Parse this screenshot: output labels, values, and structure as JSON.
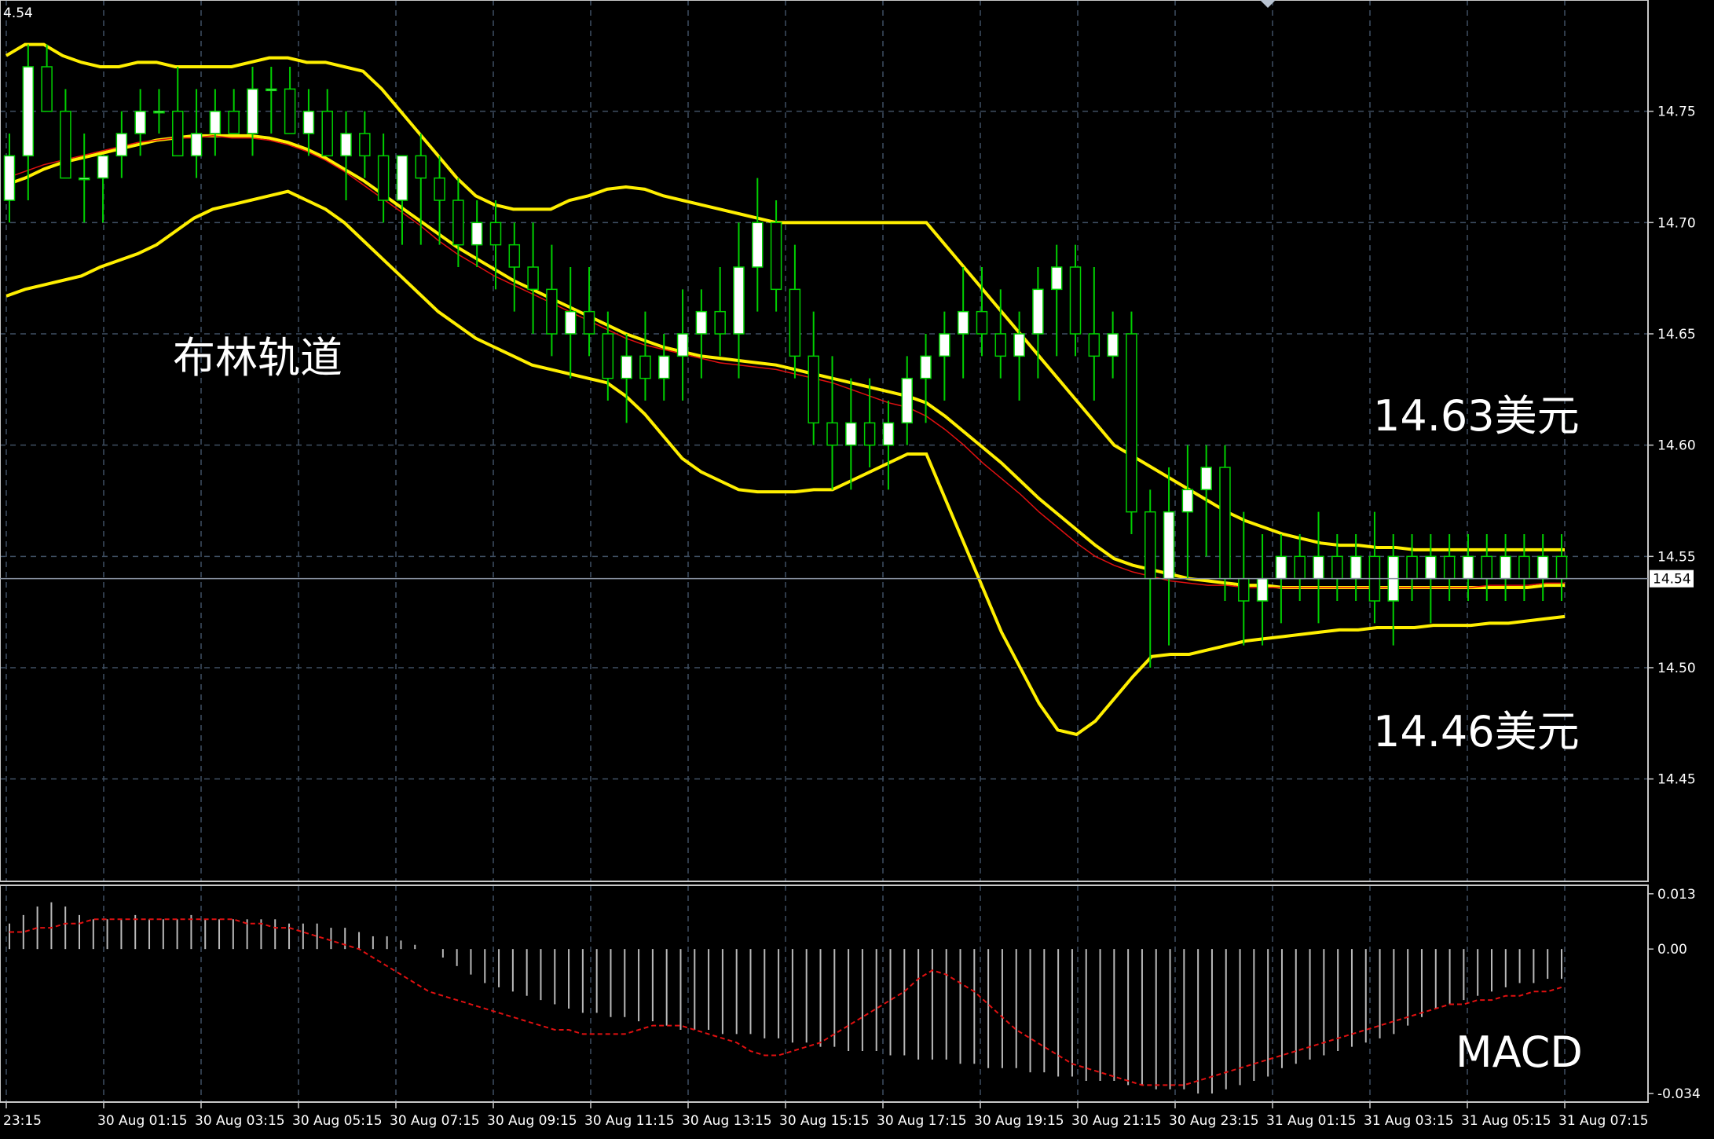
{
  "chart_data": {
    "type": "candlestick",
    "price_panel": {
      "corner_label": "4.54",
      "y_ticks": [
        "14.75",
        "14.70",
        "14.65",
        "14.60",
        "14.55",
        "14.50",
        "14.45"
      ],
      "y_tick_values": [
        14.75,
        14.7,
        14.65,
        14.6,
        14.55,
        14.5,
        14.45
      ],
      "ylim": [
        14.404,
        14.8
      ],
      "current_price": 14.54,
      "current_price_label": "14.54",
      "grid": true,
      "indicators": [
        "Bollinger Bands (upper, middle, lower)",
        "Moving average"
      ],
      "candles": [
        [
          14.71,
          14.74,
          14.7,
          14.73
        ],
        [
          14.73,
          14.78,
          14.71,
          14.77
        ],
        [
          14.77,
          14.78,
          14.75,
          14.75
        ],
        [
          14.75,
          14.76,
          14.72,
          14.72
        ],
        [
          14.72,
          14.74,
          14.7,
          14.72
        ],
        [
          14.72,
          14.73,
          14.7,
          14.73
        ],
        [
          14.73,
          14.75,
          14.72,
          14.74
        ],
        [
          14.74,
          14.76,
          14.73,
          14.75
        ],
        [
          14.75,
          14.76,
          14.74,
          14.75
        ],
        [
          14.75,
          14.77,
          14.73,
          14.73
        ],
        [
          14.73,
          14.76,
          14.72,
          14.74
        ],
        [
          14.74,
          14.76,
          14.73,
          14.75
        ],
        [
          14.75,
          14.76,
          14.74,
          14.74
        ],
        [
          14.74,
          14.77,
          14.73,
          14.76
        ],
        [
          14.76,
          14.77,
          14.74,
          14.76
        ],
        [
          14.76,
          14.77,
          14.74,
          14.74
        ],
        [
          14.74,
          14.76,
          14.73,
          14.75
        ],
        [
          14.75,
          14.76,
          14.73,
          14.73
        ],
        [
          14.73,
          14.75,
          14.71,
          14.74
        ],
        [
          14.74,
          14.75,
          14.72,
          14.73
        ],
        [
          14.73,
          14.74,
          14.7,
          14.71
        ],
        [
          14.71,
          14.73,
          14.69,
          14.73
        ],
        [
          14.73,
          14.74,
          14.69,
          14.72
        ],
        [
          14.72,
          14.73,
          14.69,
          14.71
        ],
        [
          14.71,
          14.72,
          14.68,
          14.69
        ],
        [
          14.69,
          14.71,
          14.68,
          14.7
        ],
        [
          14.7,
          14.71,
          14.67,
          14.69
        ],
        [
          14.69,
          14.7,
          14.66,
          14.68
        ],
        [
          14.68,
          14.7,
          14.65,
          14.67
        ],
        [
          14.67,
          14.69,
          14.64,
          14.65
        ],
        [
          14.65,
          14.68,
          14.63,
          14.66
        ],
        [
          14.66,
          14.68,
          14.64,
          14.65
        ],
        [
          14.65,
          14.66,
          14.62,
          14.63
        ],
        [
          14.63,
          14.65,
          14.61,
          14.64
        ],
        [
          14.64,
          14.66,
          14.62,
          14.63
        ],
        [
          14.63,
          14.65,
          14.62,
          14.64
        ],
        [
          14.64,
          14.67,
          14.62,
          14.65
        ],
        [
          14.65,
          14.67,
          14.63,
          14.66
        ],
        [
          14.66,
          14.68,
          14.64,
          14.65
        ],
        [
          14.65,
          14.7,
          14.63,
          14.68
        ],
        [
          14.68,
          14.72,
          14.66,
          14.7
        ],
        [
          14.7,
          14.71,
          14.66,
          14.67
        ],
        [
          14.67,
          14.69,
          14.63,
          14.64
        ],
        [
          14.64,
          14.66,
          14.6,
          14.61
        ],
        [
          14.61,
          14.64,
          14.58,
          14.6
        ],
        [
          14.6,
          14.63,
          14.58,
          14.61
        ],
        [
          14.61,
          14.63,
          14.59,
          14.6
        ],
        [
          14.6,
          14.62,
          14.58,
          14.61
        ],
        [
          14.61,
          14.64,
          14.6,
          14.63
        ],
        [
          14.63,
          14.65,
          14.61,
          14.64
        ],
        [
          14.64,
          14.66,
          14.62,
          14.65
        ],
        [
          14.65,
          14.68,
          14.63,
          14.66
        ],
        [
          14.66,
          14.68,
          14.64,
          14.65
        ],
        [
          14.65,
          14.67,
          14.63,
          14.64
        ],
        [
          14.64,
          14.66,
          14.62,
          14.65
        ],
        [
          14.65,
          14.68,
          14.63,
          14.67
        ],
        [
          14.67,
          14.69,
          14.64,
          14.68
        ],
        [
          14.68,
          14.69,
          14.64,
          14.65
        ],
        [
          14.65,
          14.68,
          14.62,
          14.64
        ],
        [
          14.64,
          14.66,
          14.63,
          14.65
        ],
        [
          14.65,
          14.66,
          14.56,
          14.57
        ],
        [
          14.57,
          14.58,
          14.5,
          14.54
        ],
        [
          14.54,
          14.59,
          14.51,
          14.57
        ],
        [
          14.57,
          14.6,
          14.54,
          14.58
        ],
        [
          14.58,
          14.6,
          14.55,
          14.59
        ],
        [
          14.59,
          14.6,
          14.53,
          14.54
        ],
        [
          14.54,
          14.57,
          14.51,
          14.53
        ],
        [
          14.53,
          14.56,
          14.51,
          14.54
        ],
        [
          14.54,
          14.56,
          14.52,
          14.55
        ],
        [
          14.55,
          14.56,
          14.53,
          14.54
        ],
        [
          14.54,
          14.57,
          14.52,
          14.55
        ],
        [
          14.55,
          14.56,
          14.53,
          14.54
        ],
        [
          14.54,
          14.56,
          14.53,
          14.55
        ],
        [
          14.55,
          14.57,
          14.52,
          14.53
        ],
        [
          14.53,
          14.56,
          14.51,
          14.55
        ],
        [
          14.55,
          14.56,
          14.53,
          14.54
        ],
        [
          14.54,
          14.56,
          14.52,
          14.55
        ],
        [
          14.55,
          14.56,
          14.53,
          14.54
        ],
        [
          14.54,
          14.56,
          14.53,
          14.55
        ],
        [
          14.55,
          14.56,
          14.53,
          14.54
        ],
        [
          14.54,
          14.56,
          14.53,
          14.55
        ],
        [
          14.55,
          14.56,
          14.53,
          14.54
        ],
        [
          14.54,
          14.56,
          14.53,
          14.55
        ],
        [
          14.55,
          14.56,
          14.53,
          14.54
        ]
      ],
      "bollinger_upper": [
        14.775,
        14.78,
        14.78,
        14.775,
        14.772,
        14.77,
        14.77,
        14.772,
        14.772,
        14.77,
        14.77,
        14.77,
        14.77,
        14.772,
        14.774,
        14.774,
        14.772,
        14.772,
        14.77,
        14.768,
        14.76,
        14.75,
        14.74,
        14.73,
        14.72,
        14.712,
        14.708,
        14.706,
        14.706,
        14.706,
        14.71,
        14.712,
        14.715,
        14.716,
        14.715,
        14.712,
        14.71,
        14.708,
        14.706,
        14.704,
        14.702,
        14.7,
        14.7,
        14.7,
        14.7,
        14.7,
        14.7,
        14.7,
        14.7,
        14.7,
        14.69,
        14.68,
        14.67,
        14.66,
        14.65,
        14.64,
        14.63,
        14.62,
        14.61,
        14.6,
        14.595,
        14.59,
        14.585,
        14.58,
        14.575,
        14.57,
        14.566,
        14.563,
        14.56,
        14.558,
        14.556,
        14.555,
        14.555,
        14.554,
        14.554,
        14.553,
        14.553,
        14.553,
        14.553,
        14.553,
        14.553,
        14.553,
        14.553,
        14.553
      ],
      "bollinger_middle": [
        14.717,
        14.72,
        14.724,
        14.727,
        14.729,
        14.731,
        14.733,
        14.735,
        14.737,
        14.738,
        14.739,
        14.739,
        14.739,
        14.739,
        14.738,
        14.736,
        14.733,
        14.729,
        14.724,
        14.719,
        14.713,
        14.707,
        14.701,
        14.695,
        14.689,
        14.684,
        14.679,
        14.674,
        14.67,
        14.666,
        14.662,
        14.658,
        14.654,
        14.65,
        14.647,
        14.644,
        14.642,
        14.64,
        14.639,
        14.638,
        14.637,
        14.636,
        14.634,
        14.632,
        14.63,
        14.628,
        14.626,
        14.624,
        14.622,
        14.619,
        14.613,
        14.606,
        14.599,
        14.592,
        14.584,
        14.576,
        14.569,
        14.562,
        14.555,
        14.549,
        14.546,
        14.544,
        14.542,
        14.54,
        14.539,
        14.538,
        14.537,
        14.537,
        14.536,
        14.536,
        14.536,
        14.536,
        14.536,
        14.536,
        14.536,
        14.536,
        14.536,
        14.536,
        14.536,
        14.536,
        14.536,
        14.536,
        14.537,
        14.537
      ],
      "bollinger_lower": [
        14.667,
        14.67,
        14.672,
        14.674,
        14.676,
        14.68,
        14.683,
        14.686,
        14.69,
        14.696,
        14.702,
        14.706,
        14.708,
        14.71,
        14.712,
        14.714,
        14.71,
        14.706,
        14.7,
        14.692,
        14.684,
        14.676,
        14.668,
        14.66,
        14.654,
        14.648,
        14.644,
        14.64,
        14.636,
        14.634,
        14.632,
        14.63,
        14.628,
        14.622,
        14.614,
        14.604,
        14.594,
        14.588,
        14.584,
        14.58,
        14.579,
        14.579,
        14.579,
        14.58,
        14.58,
        14.584,
        14.588,
        14.592,
        14.596,
        14.596,
        14.576,
        14.556,
        14.536,
        14.516,
        14.5,
        14.484,
        14.472,
        14.47,
        14.476,
        14.486,
        14.496,
        14.505,
        14.506,
        14.506,
        14.508,
        14.51,
        14.512,
        14.513,
        14.514,
        14.515,
        14.516,
        14.517,
        14.517,
        14.518,
        14.518,
        14.518,
        14.519,
        14.519,
        14.519,
        14.52,
        14.52,
        14.521,
        14.522,
        14.523
      ],
      "moving_average": [
        14.72,
        14.723,
        14.726,
        14.728,
        14.73,
        14.732,
        14.734,
        14.736,
        14.737,
        14.738,
        14.738,
        14.739,
        14.738,
        14.738,
        14.737,
        14.735,
        14.732,
        14.728,
        14.723,
        14.717,
        14.711,
        14.705,
        14.699,
        14.692,
        14.686,
        14.681,
        14.676,
        14.672,
        14.668,
        14.664,
        14.66,
        14.656,
        14.652,
        14.648,
        14.645,
        14.643,
        14.641,
        14.639,
        14.637,
        14.636,
        14.635,
        14.634,
        14.632,
        14.63,
        14.628,
        14.625,
        14.622,
        14.619,
        14.617,
        14.613,
        14.607,
        14.6,
        14.592,
        14.585,
        14.578,
        14.57,
        14.563,
        14.556,
        14.55,
        14.546,
        14.543,
        14.541,
        14.539,
        14.538,
        14.537,
        14.537,
        14.536,
        14.536,
        14.536,
        14.536,
        14.536,
        14.536,
        14.536,
        14.536,
        14.536,
        14.536,
        14.536,
        14.536,
        14.536,
        14.537,
        14.537,
        14.537,
        14.538,
        14.538
      ]
    },
    "macd_panel": {
      "title": "MACD",
      "y_ticks": [
        "0.013",
        "0.00",
        "-0.034"
      ],
      "y_tick_values": [
        0.013,
        0.0,
        -0.034
      ],
      "ylim": [
        -0.036,
        0.015
      ],
      "histogram": [
        0.006,
        0.008,
        0.01,
        0.011,
        0.01,
        0.008,
        0.007,
        0.007,
        0.007,
        0.008,
        0.007,
        0.007,
        0.007,
        0.008,
        0.007,
        0.007,
        0.007,
        0.007,
        0.007,
        0.007,
        0.006,
        0.006,
        0.006,
        0.005,
        0.005,
        0.004,
        0.003,
        0.003,
        0.002,
        0.001,
        0.0,
        -0.002,
        -0.004,
        -0.006,
        -0.008,
        -0.009,
        -0.01,
        -0.011,
        -0.012,
        -0.013,
        -0.014,
        -0.015,
        -0.015,
        -0.016,
        -0.016,
        -0.017,
        -0.017,
        -0.018,
        -0.019,
        -0.019,
        -0.019,
        -0.02,
        -0.02,
        -0.02,
        -0.021,
        -0.021,
        -0.022,
        -0.022,
        -0.023,
        -0.023,
        -0.024,
        -0.024,
        -0.024,
        -0.025,
        -0.025,
        -0.026,
        -0.026,
        -0.026,
        -0.027,
        -0.027,
        -0.028,
        -0.028,
        -0.028,
        -0.029,
        -0.029,
        -0.03,
        -0.03,
        -0.031,
        -0.031,
        -0.031,
        -0.032,
        -0.032,
        -0.033,
        -0.033,
        -0.033,
        -0.034,
        -0.034,
        -0.033,
        -0.032,
        -0.031,
        -0.03,
        -0.028,
        -0.027,
        -0.026,
        -0.025,
        -0.024,
        -0.023,
        -0.022,
        -0.021,
        -0.02,
        -0.018,
        -0.016,
        -0.014,
        -0.013,
        -0.012,
        -0.011,
        -0.01,
        -0.009,
        -0.008,
        -0.008,
        -0.007,
        -0.007
      ],
      "signal": [
        0.004,
        0.004,
        0.005,
        0.005,
        0.006,
        0.006,
        0.007,
        0.007,
        0.007,
        0.007,
        0.007,
        0.007,
        0.007,
        0.007,
        0.007,
        0.007,
        0.007,
        0.006,
        0.006,
        0.005,
        0.005,
        0.004,
        0.003,
        0.002,
        0.001,
        0.0,
        -0.002,
        -0.004,
        -0.006,
        -0.008,
        -0.01,
        -0.011,
        -0.012,
        -0.013,
        -0.014,
        -0.015,
        -0.016,
        -0.017,
        -0.018,
        -0.019,
        -0.019,
        -0.02,
        -0.02,
        -0.02,
        -0.02,
        -0.019,
        -0.018,
        -0.018,
        -0.018,
        -0.019,
        -0.02,
        -0.021,
        -0.022,
        -0.024,
        -0.025,
        -0.025,
        -0.024,
        -0.023,
        -0.022,
        -0.02,
        -0.018,
        -0.016,
        -0.014,
        -0.012,
        -0.01,
        -0.007,
        -0.005,
        -0.006,
        -0.008,
        -0.01,
        -0.013,
        -0.016,
        -0.019,
        -0.021,
        -0.023,
        -0.025,
        -0.027,
        -0.028,
        -0.029,
        -0.03,
        -0.031,
        -0.032,
        -0.032,
        -0.032,
        -0.032,
        -0.031,
        -0.03,
        -0.029,
        -0.028,
        -0.027,
        -0.026,
        -0.025,
        -0.024,
        -0.023,
        -0.022,
        -0.021,
        -0.02,
        -0.019,
        -0.018,
        -0.017,
        -0.016,
        -0.015,
        -0.014,
        -0.013,
        -0.013,
        -0.012,
        -0.012,
        -0.011,
        -0.011,
        -0.01,
        -0.01,
        -0.009
      ]
    },
    "x_ticks": [
      "23:15",
      "30 Aug 01:15",
      "30 Aug 03:15",
      "30 Aug 05:15",
      "30 Aug 07:15",
      "30 Aug 09:15",
      "30 Aug 11:15",
      "30 Aug 13:15",
      "30 Aug 15:15",
      "30 Aug 17:15",
      "30 Aug 19:15",
      "30 Aug 21:15",
      "30 Aug 23:15",
      "31 Aug 01:15",
      "31 Aug 03:15",
      "31 Aug 05:15",
      "31 Aug 07:15"
    ],
    "annotations": {
      "bollinger_label": "布林轨道",
      "upper_price_label": "14.63美元",
      "lower_price_label": "14.46美元"
    },
    "colors": {
      "background": "#000000",
      "grid": "#3f4f63",
      "bullish_candle": "#ffffff",
      "candle_wick": "#00d000",
      "bollinger": "#ffef00",
      "moving_average": "#e01010",
      "macd_histogram": "#b9b9b9",
      "macd_signal": "#e01010",
      "axis_text": "#ffffff"
    }
  }
}
